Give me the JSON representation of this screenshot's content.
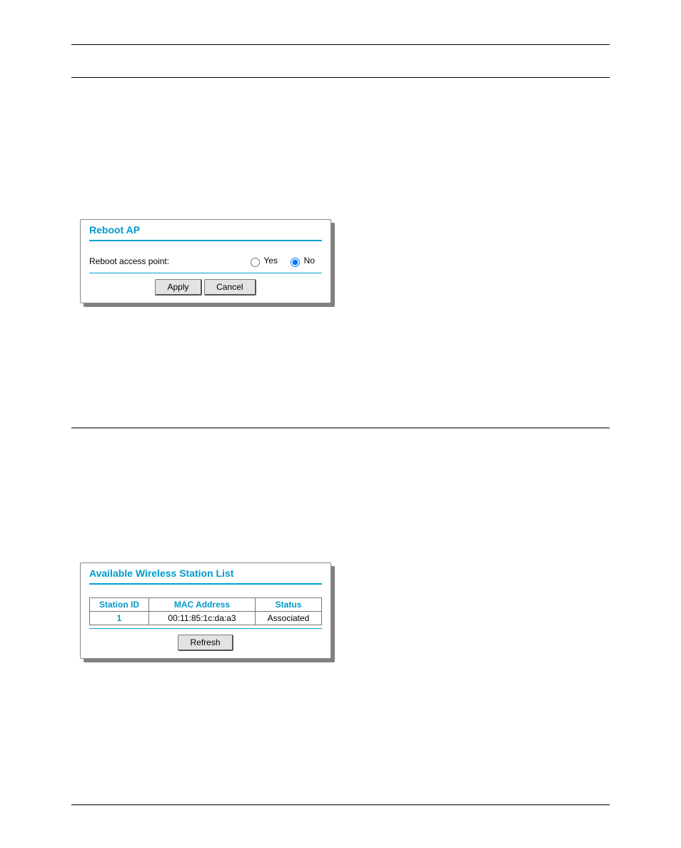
{
  "reboot_panel": {
    "title": "Reboot AP",
    "row_label": "Reboot access point:",
    "yes_label": "Yes",
    "no_label": "No",
    "apply_label": "Apply",
    "cancel_label": "Cancel"
  },
  "station_panel": {
    "title": "Available Wireless Station List",
    "headers": {
      "id": "Station ID",
      "mac": "MAC Address",
      "status": "Status"
    },
    "rows": [
      {
        "id": "1",
        "mac": "00:11:85:1c:da:a3",
        "status": "Associated"
      }
    ],
    "refresh_label": "Refresh"
  }
}
